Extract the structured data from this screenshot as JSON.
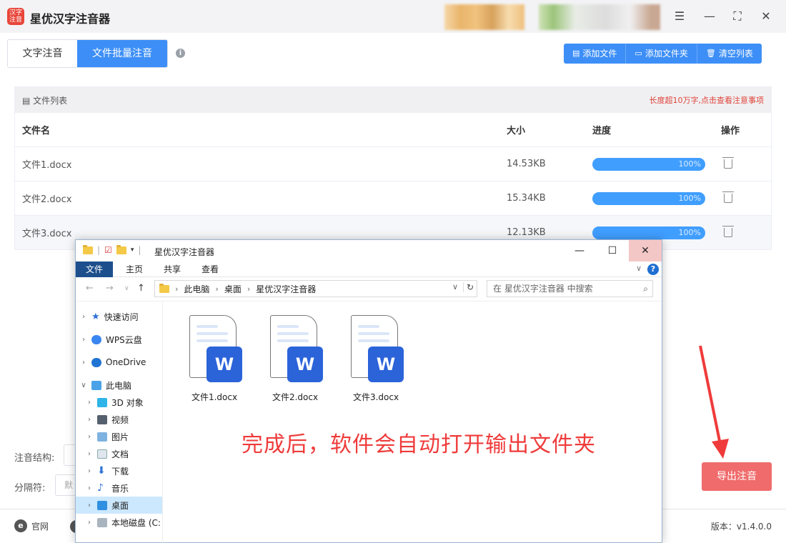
{
  "app": {
    "title": "星优汉字注音器",
    "logo_text": "汉字注音"
  },
  "tabs": [
    {
      "label": "文字注音",
      "active": false
    },
    {
      "label": "文件批量注音",
      "active": true
    }
  ],
  "toolbar": {
    "add_file": "添加文件",
    "add_folder": "添加文件夹",
    "clear_list": "清空列表"
  },
  "file_list": {
    "title": "文件列表",
    "warning": "长度超10万字,点击查看注意事项",
    "columns": {
      "name": "文件名",
      "size": "大小",
      "progress": "进度",
      "action": "操作"
    },
    "rows": [
      {
        "name": "文件1.docx",
        "size": "14.53KB",
        "progress": "100%"
      },
      {
        "name": "文件2.docx",
        "size": "15.34KB",
        "progress": "100%"
      },
      {
        "name": "文件3.docx",
        "size": "12.13KB",
        "progress": "100%"
      }
    ]
  },
  "settings": {
    "structure_label": "注音结构:",
    "separator_label": "分隔符:",
    "separator_value": "默"
  },
  "export_button": "导出注音",
  "footer": {
    "site": "官网",
    "version": "版本：v1.4.0.0"
  },
  "annotation": "完成后，软件会自动打开输出文件夹",
  "explorer": {
    "title": "星优汉字注音器",
    "ribbon": [
      "文件",
      "主页",
      "共享",
      "查看"
    ],
    "path": [
      "此电脑",
      "桌面",
      "星优汉字注音器"
    ],
    "search_placeholder": "在 星优汉字注音器 中搜索",
    "sidebar": [
      {
        "label": "快速访问",
        "icon": "star-icon",
        "indent": 0
      },
      {
        "label": "WPS云盘",
        "icon": "cloud-icon",
        "indent": 0
      },
      {
        "label": "OneDrive",
        "icon": "onedrive-icon",
        "indent": 0
      },
      {
        "label": "此电脑",
        "icon": "computer-icon",
        "indent": 0
      },
      {
        "label": "3D 对象",
        "icon": "cube-icon",
        "indent": 1
      },
      {
        "label": "视频",
        "icon": "video-icon",
        "indent": 1
      },
      {
        "label": "图片",
        "icon": "picture-icon",
        "indent": 1
      },
      {
        "label": "文档",
        "icon": "document-icon",
        "indent": 1
      },
      {
        "label": "下载",
        "icon": "download-icon",
        "indent": 1
      },
      {
        "label": "音乐",
        "icon": "music-icon",
        "indent": 1
      },
      {
        "label": "桌面",
        "icon": "desktop-icon",
        "indent": 1,
        "selected": true
      },
      {
        "label": "本地磁盘 (C:",
        "icon": "drive-icon",
        "indent": 1
      }
    ],
    "files": [
      {
        "name": "文件1.docx",
        "badge": "W"
      },
      {
        "name": "文件2.docx",
        "badge": "W"
      },
      {
        "name": "文件3.docx",
        "badge": "W"
      }
    ]
  },
  "colors": {
    "accent": "#3d8ff7",
    "export": "#f06b6b",
    "annotation": "#ef3b3b",
    "progress": "#409eff"
  }
}
